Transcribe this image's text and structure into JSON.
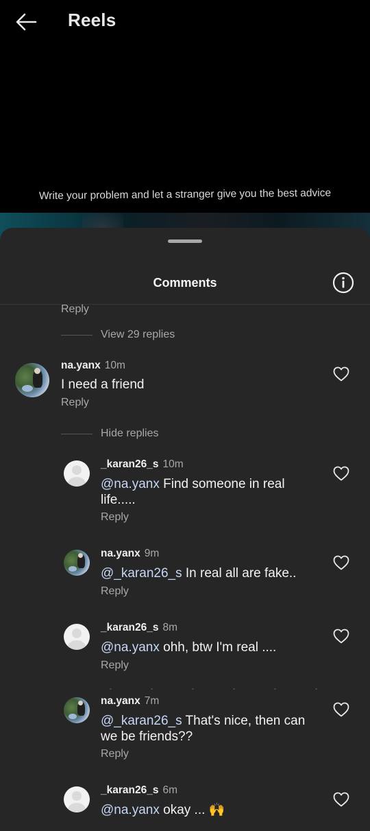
{
  "header": {
    "title": "Reels",
    "back_icon": "arrow-left-icon"
  },
  "video": {
    "caption": "Write your problem and let a stranger give you the best advice"
  },
  "sheet": {
    "title": "Comments",
    "info_icon": "info-icon"
  },
  "thread": {
    "top_reply_label": "Reply",
    "view_replies_label": "View 29 replies",
    "comment": {
      "username": "na.yanx",
      "time": "10m",
      "text": "I need a friend",
      "reply_label": "Reply"
    },
    "hide_replies_label": "Hide replies",
    "replies": [
      {
        "username": "_karan26_s",
        "time": "10m",
        "mention": "@na.yanx",
        "text_line1": " Find someone in real",
        "text_line2": "life.....",
        "reply_label": "Reply"
      },
      {
        "username": "na.yanx",
        "time": "9m",
        "mention": "@_karan26_s",
        "text_line1": " In real all are fake..",
        "reply_label": "Reply"
      },
      {
        "username": "_karan26_s",
        "time": "8m",
        "mention": "@na.yanx",
        "text_line1": " ohh, btw I'm real ....",
        "reply_label": "Reply"
      },
      {
        "username": "na.yanx",
        "time": "7m",
        "mention": "@_karan26_s",
        "text_line1": " That's nice, then can",
        "text_line2": "we be friends??",
        "reply_label": "Reply"
      },
      {
        "username": "_karan26_s",
        "time": "6m",
        "mention": "@na.yanx",
        "text_line1": " okay ... ",
        "emoji": "🙌"
      }
    ]
  },
  "colors": {
    "sheet_bg": "#262626",
    "screen_bg": "#000000",
    "muted_text": "#a8a8a8",
    "mention": "#c5d6f6"
  }
}
